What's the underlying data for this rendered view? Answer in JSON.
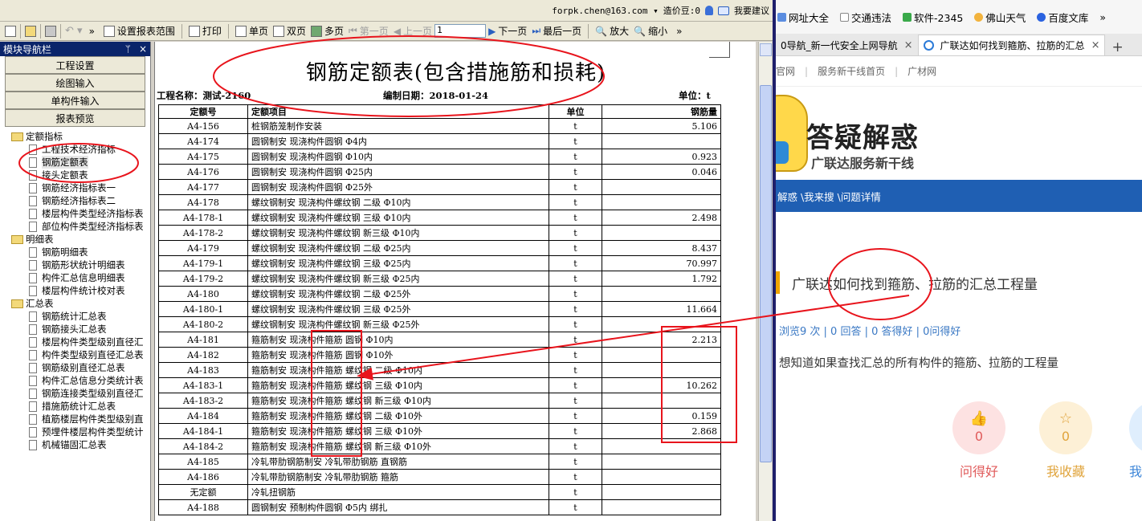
{
  "app": {
    "user": "forpk.chen@163.com ▾",
    "coins": "造价豆:0",
    "feedback": "我要建议"
  },
  "toolbar": {
    "set_range": "设置报表范围",
    "print": "打印",
    "single_page": "单页",
    "double_page": "双页",
    "multi_page": "多页",
    "first_page": "第一页",
    "prev_page": "上一页",
    "page_value": "1",
    "next_page": "下一页",
    "last_page": "最后一页",
    "zoom_in": "放大",
    "zoom_out": "缩小"
  },
  "nav": {
    "title": "模块导航栏",
    "pin": "ᛘ",
    "close": "×",
    "tabs": [
      "工程设置",
      "绘图输入",
      "单构件输入",
      "报表预览"
    ],
    "groups": [
      {
        "label": "定额指标",
        "items": [
          "工程技术经济指标",
          "钢筋定额表",
          "接头定额表",
          "钢筋经济指标表一",
          "钢筋经济指标表二",
          "楼层构件类型经济指标表",
          "部位构件类型经济指标表"
        ]
      },
      {
        "label": "明细表",
        "items": [
          "钢筋明细表",
          "钢筋形状统计明细表",
          "构件汇总信息明细表",
          "楼层构件统计校对表"
        ]
      },
      {
        "label": "汇总表",
        "items": [
          "钢筋统计汇总表",
          "钢筋接头汇总表",
          "楼层构件类型级别直径汇",
          "构件类型级别直径汇总表",
          "钢筋级别直径汇总表",
          "构件汇总信息分类统计表",
          "钢筋连接类型级别直径汇",
          "措施筋统计汇总表",
          "植筋楼层构件类型级别直",
          "预埋件楼层构件类型统计",
          "机械锚固汇总表"
        ]
      }
    ]
  },
  "report": {
    "title": "钢筋定额表(包含措施筋和损耗)",
    "project": "工程名称：测试-2160",
    "date": "编制日期：2018-01-24",
    "unit": "单位：t",
    "headers": [
      "定额号",
      "定额项目",
      "单位",
      "钢筋量"
    ],
    "rows": [
      [
        "A4-156",
        "桩钢筋笼制作安装",
        "t",
        "5.106"
      ],
      [
        "A4-174",
        "圆钢制安 现浇构件圆钢 Φ4内",
        "t",
        ""
      ],
      [
        "A4-175",
        "圆钢制安 现浇构件圆钢 Φ10内",
        "t",
        "0.923"
      ],
      [
        "A4-176",
        "圆钢制安 现浇构件圆钢 Φ25内",
        "t",
        "0.046"
      ],
      [
        "A4-177",
        "圆钢制安 现浇构件圆钢 Φ25外",
        "t",
        ""
      ],
      [
        "A4-178",
        "螺纹钢制安 现浇构件螺纹钢 二级 Φ10内",
        "t",
        ""
      ],
      [
        "A4-178-1",
        "螺纹钢制安 现浇构件螺纹钢 三级 Φ10内",
        "t",
        "2.498"
      ],
      [
        "A4-178-2",
        "螺纹钢制安 现浇构件螺纹钢 新三级 Φ10内",
        "t",
        ""
      ],
      [
        "A4-179",
        "螺纹钢制安 现浇构件螺纹钢 二级 Φ25内",
        "t",
        "8.437"
      ],
      [
        "A4-179-1",
        "螺纹钢制安 现浇构件螺纹钢 三级 Φ25内",
        "t",
        "70.997"
      ],
      [
        "A4-179-2",
        "螺纹钢制安 现浇构件螺纹钢 新三级 Φ25内",
        "t",
        "1.792"
      ],
      [
        "A4-180",
        "螺纹钢制安 现浇构件螺纹钢 二级 Φ25外",
        "t",
        ""
      ],
      [
        "A4-180-1",
        "螺纹钢制安 现浇构件螺纹钢 三级 Φ25外",
        "t",
        "11.664"
      ],
      [
        "A4-180-2",
        "螺纹钢制安 现浇构件螺纹钢 新三级 Φ25外",
        "t",
        ""
      ],
      [
        "A4-181",
        "箍筋制安 现浇构件箍筋 圆钢 Φ10内",
        "t",
        "2.213"
      ],
      [
        "A4-182",
        "箍筋制安 现浇构件箍筋 圆钢 Φ10外",
        "t",
        ""
      ],
      [
        "A4-183",
        "箍筋制安 现浇构件箍筋 螺纹钢 二级 Φ10内",
        "t",
        ""
      ],
      [
        "A4-183-1",
        "箍筋制安 现浇构件箍筋 螺纹钢  三级 Φ10内",
        "t",
        "10.262"
      ],
      [
        "A4-183-2",
        "箍筋制安 现浇构件箍筋 螺纹钢  新三级 Φ10内",
        "t",
        ""
      ],
      [
        "A4-184",
        "箍筋制安 现浇构件箍筋 螺纹钢 二级 Φ10外",
        "t",
        "0.159"
      ],
      [
        "A4-184-1",
        "箍筋制安 现浇构件箍筋 螺纹钢 三级 Φ10外",
        "t",
        "2.868"
      ],
      [
        "A4-184-2",
        "箍筋制安 现浇构件箍筋 螺纹钢 新三级 Φ10外",
        "t",
        ""
      ],
      [
        "A4-185",
        "冷轧带肋钢筋制安 冷轧带肋钢筋 直钢筋",
        "t",
        ""
      ],
      [
        "A4-186",
        "冷轧带肋钢筋制安 冷轧带肋钢筋 箍筋",
        "t",
        ""
      ],
      [
        "无定额",
        "冷轧扭钢筋",
        "t",
        ""
      ],
      [
        "A4-188",
        "圆钢制安 预制构件圆钢 Φ5内 绑扎",
        "t",
        ""
      ]
    ]
  },
  "browser": {
    "bookmarks": [
      "网址大全",
      "交通违法",
      "软件-2345",
      "佛山天气",
      "百度文库",
      "»"
    ],
    "tabs": [
      {
        "label": "0导航_新一代安全上网导航",
        "close": "×"
      },
      {
        "label": "广联达如何找到箍筋、拉筋的汇总",
        "close": "×"
      }
    ],
    "new_tab": "+",
    "site_nav": [
      "官网",
      "服务新干线首页",
      "广材网"
    ],
    "banner_title": "答疑解惑",
    "banner_sub": "广联达服务新干线",
    "crumbs": "解惑 \\我来搜 \\问题详情",
    "question_title": "广联达如何找到箍筋、拉筋的汇总工程量",
    "stats": "浏览9 次 | 0 回答 | 0 答得好 | 0问得好",
    "body": "想知道如果查找汇总的所有构件的箍筋、拉筋的工程量",
    "actions": [
      {
        "count": "0",
        "label": "问得好"
      },
      {
        "count": "0",
        "label": "我收藏"
      },
      {
        "count": "",
        "label": "我"
      }
    ]
  },
  "colors": {
    "annotation_red": "#e8141c",
    "nav_header": "#0a246a",
    "crumb_bar": "#1f5fb3"
  }
}
